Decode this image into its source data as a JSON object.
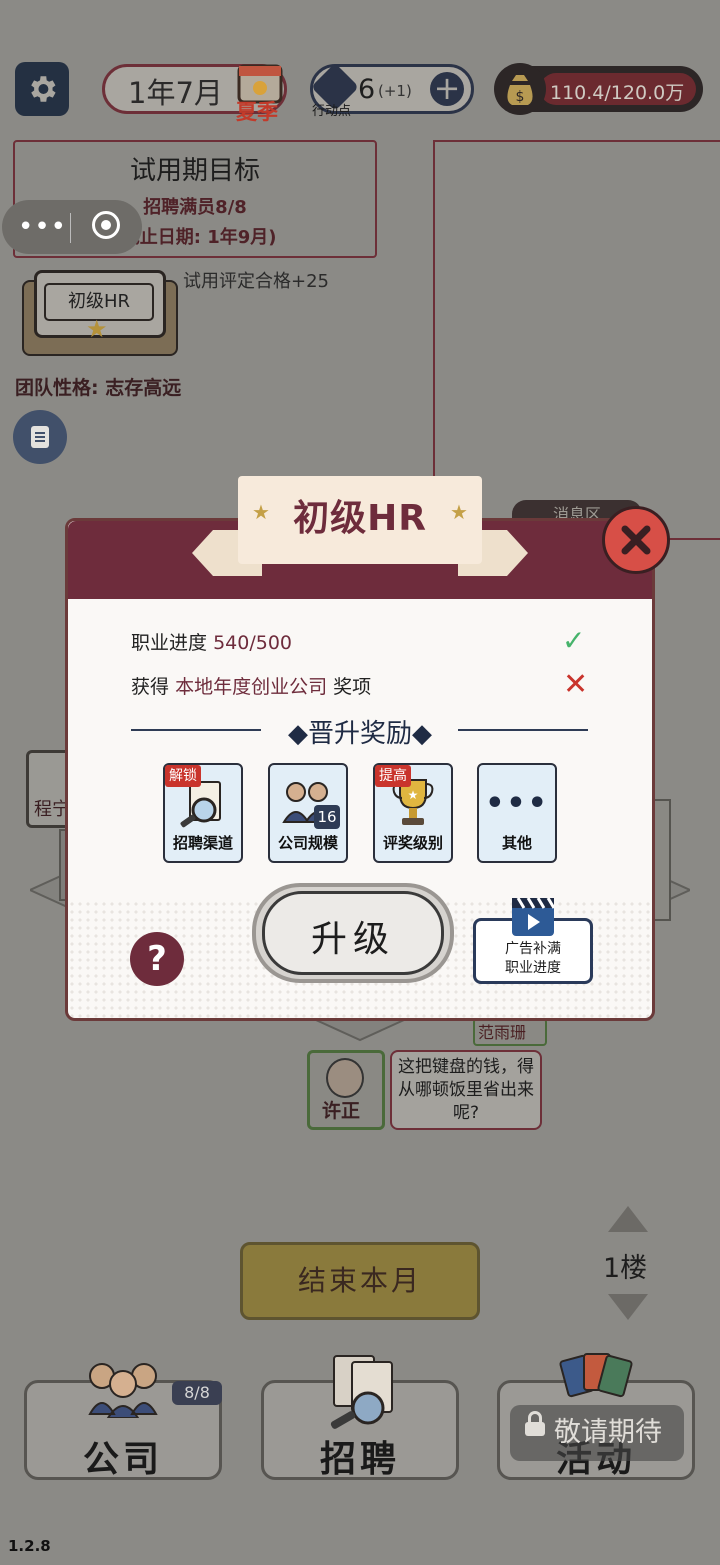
{
  "header": {
    "date": "1年7月",
    "season": "夏季",
    "action_points": "6",
    "action_points_bonus": "(+1)",
    "action_points_label": "行动点",
    "money": "110.4/120.0万"
  },
  "goal": {
    "title": "试用期目标",
    "line1": "招聘满员8/8",
    "line2": "(截止日期: 1年9月)",
    "bonus": "试用评定合格+25"
  },
  "rank_plaque": "初级HR",
  "team": "团队性格: 志存高远",
  "message_tab": "消息区",
  "office": {
    "employee_a": "程宁",
    "employee_b": "许正",
    "employee_c": "范雨珊",
    "bubble": "这把键盘的钱，得从哪顿饭里省出来呢?"
  },
  "floor": "1楼",
  "end_month": "结束本月",
  "tabs": [
    {
      "label": "公司",
      "badge": "8/8"
    },
    {
      "label": "招聘"
    },
    {
      "label": "活动",
      "lock": "敬请期待"
    }
  ],
  "version": "1.2.8",
  "modal": {
    "title": "初级HR",
    "req1_prefix": "职业进度",
    "req1_value": "540/500",
    "req2_prefix": "获得",
    "req2_award": "本地年度创业公司",
    "req2_suffix": "奖项",
    "section_title": "◆晋升奖励◆",
    "rewards": [
      {
        "label": "招聘渠道",
        "tag": "解锁"
      },
      {
        "label": "公司规模",
        "badge": "16"
      },
      {
        "label": "评奖级别",
        "tag": "提高"
      },
      {
        "label": "其他"
      }
    ],
    "upgrade": "升级",
    "ad_line1": "广告补满",
    "ad_line2": "职业进度"
  },
  "colors": {
    "accent": "#6e2c3c",
    "check": "#46b36b",
    "cross": "#c9342c"
  }
}
